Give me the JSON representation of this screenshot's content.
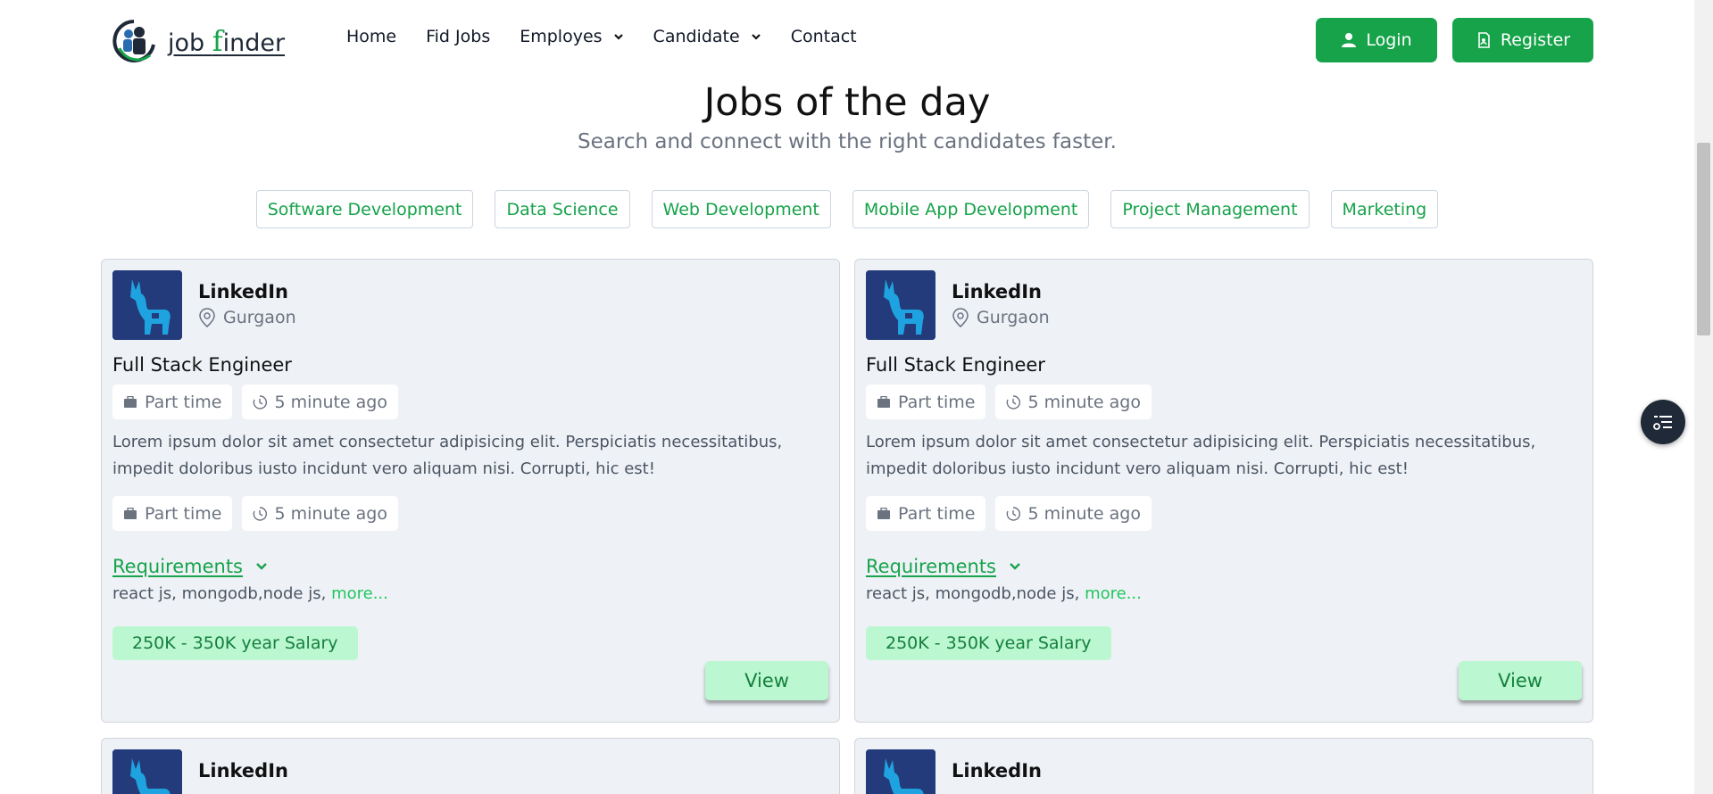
{
  "brand": {
    "name_prefix": "job ",
    "name_accent": "f",
    "name_suffix": "inder"
  },
  "nav": {
    "items": [
      {
        "label": "Home",
        "dropdown": false
      },
      {
        "label": "Fid Jobs",
        "dropdown": false
      },
      {
        "label": "Employes",
        "dropdown": true
      },
      {
        "label": "Candidate",
        "dropdown": true
      },
      {
        "label": "Contact",
        "dropdown": false
      }
    ]
  },
  "auth": {
    "login_label": "Login",
    "register_label": "Register"
  },
  "section": {
    "title": "Jobs of the day",
    "subtitle": "Search and connect with the right candidates faster."
  },
  "categories": [
    "Software Development",
    "Data Science",
    "Web Development",
    "Mobile App Development",
    "Project Management",
    "Marketing"
  ],
  "jobs": [
    {
      "company": "LinkedIn",
      "location": "Gurgaon",
      "role": "Full Stack Engineer",
      "type": "Part time",
      "posted": "5 minute ago",
      "description": "Lorem ipsum dolor sit amet consectetur adipisicing elit. Perspiciatis necessitatibus, impedit doloribus iusto incidunt vero aliquam nisi. Corrupti, hic est!",
      "requirements_label": "Requirements",
      "skills": "react js, mongodb,node js,",
      "more_label": "more...",
      "salary": "250K - 350K year Salary",
      "view_label": "View"
    },
    {
      "company": "LinkedIn",
      "location": "Gurgaon",
      "role": "Full Stack Engineer",
      "type": "Part time",
      "posted": "5 minute ago",
      "description": "Lorem ipsum dolor sit amet consectetur adipisicing elit. Perspiciatis necessitatibus, impedit doloribus iusto incidunt vero aliquam nisi. Corrupti, hic est!",
      "requirements_label": "Requirements",
      "skills": "react js, mongodb,node js,",
      "more_label": "more...",
      "salary": "250K - 350K year Salary",
      "view_label": "View"
    },
    {
      "company": "LinkedIn"
    },
    {
      "company": "LinkedIn"
    }
  ],
  "colors": {
    "accent": "#16a34a",
    "card_bg": "#eef2f7",
    "salary_bg": "#bbf7d0",
    "logo_bg": "#233b7a"
  },
  "icons": [
    "brand-logo-icon",
    "user-icon",
    "register-icon",
    "location-pin-icon",
    "briefcase-icon",
    "clock-icon",
    "chevron-down-icon",
    "filter-icon"
  ]
}
